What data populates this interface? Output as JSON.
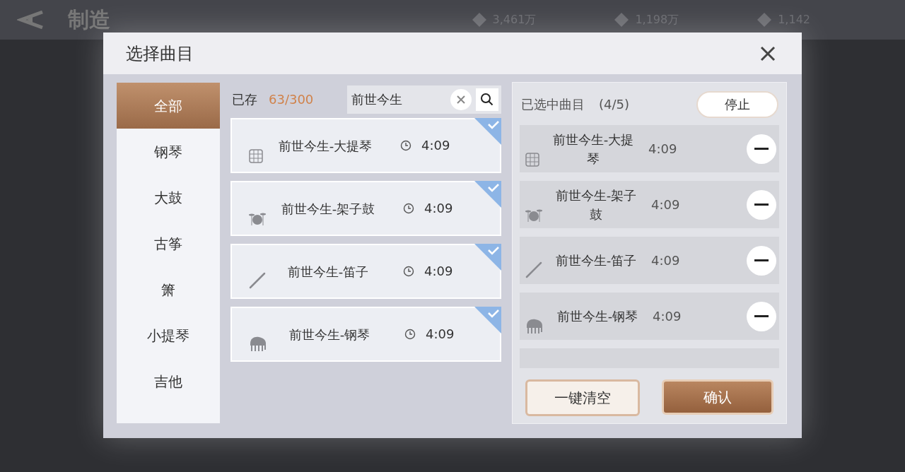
{
  "background": {
    "title": "制造",
    "currencies": [
      {
        "amount": "3,461万"
      },
      {
        "amount": "1,198万"
      },
      {
        "amount": "1,142"
      }
    ]
  },
  "dialog": {
    "title": "选择曲目",
    "categories": [
      {
        "label": "全部",
        "selected": true
      },
      {
        "label": "钢琴",
        "selected": false
      },
      {
        "label": "大鼓",
        "selected": false
      },
      {
        "label": "古筝",
        "selected": false
      },
      {
        "label": "箫",
        "selected": false
      },
      {
        "label": "小提琴",
        "selected": false
      },
      {
        "label": "吉他",
        "selected": false
      }
    ],
    "stored_label": "已存",
    "stored_count": "63/300",
    "search": {
      "value": "前世今生"
    },
    "songs": [
      {
        "kind": "grid",
        "title": "前世今生-大提琴",
        "duration": "4:09",
        "checked": true
      },
      {
        "kind": "drum",
        "title": "前世今生-架子鼓",
        "duration": "4:09",
        "checked": true
      },
      {
        "kind": "flute",
        "title": "前世今生-笛子",
        "duration": "4:09",
        "checked": true
      },
      {
        "kind": "piano",
        "title": "前世今生-钢琴",
        "duration": "4:09",
        "checked": true
      }
    ],
    "selected_panel": {
      "title": "已选中曲目",
      "count": "(4/5)",
      "stop_button": "停止",
      "songs": [
        {
          "kind": "grid",
          "title": "前世今生-大提琴",
          "duration": "4:09"
        },
        {
          "kind": "drum",
          "title": "前世今生-架子鼓",
          "duration": "4:09"
        },
        {
          "kind": "flute",
          "title": "前世今生-笛子",
          "duration": "4:09"
        },
        {
          "kind": "piano",
          "title": "前世今生-钢琴",
          "duration": "4:09"
        }
      ]
    },
    "buttons": {
      "clear": "一键清空",
      "confirm": "确认"
    }
  }
}
